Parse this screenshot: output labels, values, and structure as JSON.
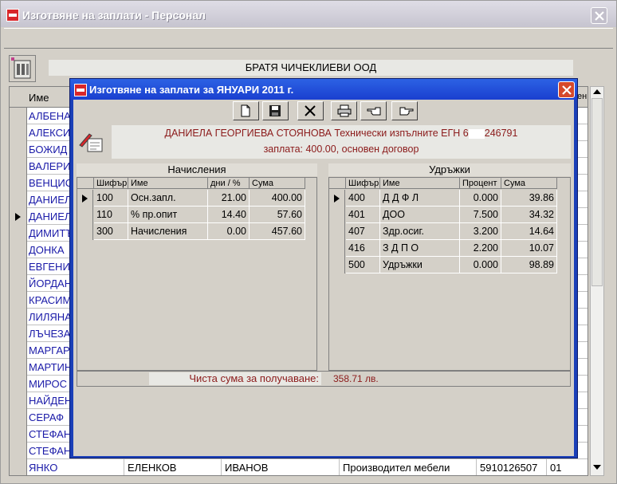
{
  "window": {
    "title": "Изготвяне  на заплати - Персонал",
    "company": "БРАТЯ ЧИЧЕКЛИЕВИ ООД"
  },
  "grid": {
    "header_name": "Име",
    "header_right": "ен",
    "names": [
      "АЛБЕНА",
      "АЛЕКСИ",
      "БОЖИД",
      "ВАЛЕРИ",
      "ВЕНЦИС",
      "ДАНИЕЛ",
      "ДАНИЕЛ",
      "ДИМИТЪ",
      "ДОНКА",
      "ЕВГЕНИ",
      "ЙОРДАН",
      "КРАСИМ",
      "ЛИЛЯНА",
      "ЛЪЧЕЗА",
      "МАРГАР",
      "МАРТИН",
      "МИРОС",
      "НАЙДЕН",
      "СЕРАФ",
      "СТЕФАН",
      "СТЕФАН"
    ],
    "last_row": {
      "name": "ЯНКО",
      "middle": "ЕЛЕНКОВ",
      "family": "ИВАНОВ",
      "position": "Производител мебели",
      "egn": "5910126507",
      "code": "01"
    }
  },
  "dialog": {
    "title": "Изготвяне  на заплати за ЯНУАРИ 2011 г.",
    "employee_line1": "ДАНИЕЛА ГЕОРГИЕВА СТОЯНОВА Технически изпълните ЕГН 6",
    "employee_egn_tail": "246791",
    "employee_line2": "заплата:  400.00,   основен договор",
    "accruals": {
      "title": "Начисления",
      "col_code": "Шифър",
      "col_name": "Име",
      "col_days": "дни / %",
      "col_sum": "Сума",
      "rows": [
        {
          "code": "100",
          "name": "Осн.запл.",
          "days": "21.00",
          "sum": "400.00"
        },
        {
          "code": "110",
          "name": "% пр.опит",
          "days": "14.40",
          "sum": "57.60"
        },
        {
          "code": "300",
          "name": "Начисления",
          "days": "0.00",
          "sum": "457.60"
        }
      ]
    },
    "deductions": {
      "title": "Удръжки",
      "col_code": "Шифър",
      "col_name": "Име",
      "col_percent": "Процент",
      "col_sum": "Сума",
      "rows": [
        {
          "code": "400",
          "name": "Д Д Ф Л",
          "percent": "0.000",
          "sum": "39.86"
        },
        {
          "code": "401",
          "name": "ДОО",
          "percent": "7.500",
          "sum": "34.32"
        },
        {
          "code": "407",
          "name": "Здр.осиг.",
          "percent": "3.200",
          "sum": "14.64"
        },
        {
          "code": "416",
          "name": "З Д П О",
          "percent": "2.200",
          "sum": "10.07"
        },
        {
          "code": "500",
          "name": "Удръжки",
          "percent": "0.000",
          "sum": "98.89"
        }
      ]
    },
    "net_label": "Чиста сума за получаване:",
    "net_value": "358.71 лв."
  },
  "colors": {
    "dialog_frame": "#1a3fb8",
    "accent_text": "#8b1a1a",
    "name_text": "#1a1aa8"
  },
  "icons": [
    "new-document-icon",
    "save-icon",
    "delete-icon",
    "print-icon",
    "pointing-hand-left-icon",
    "pointing-hand-right-icon"
  ]
}
